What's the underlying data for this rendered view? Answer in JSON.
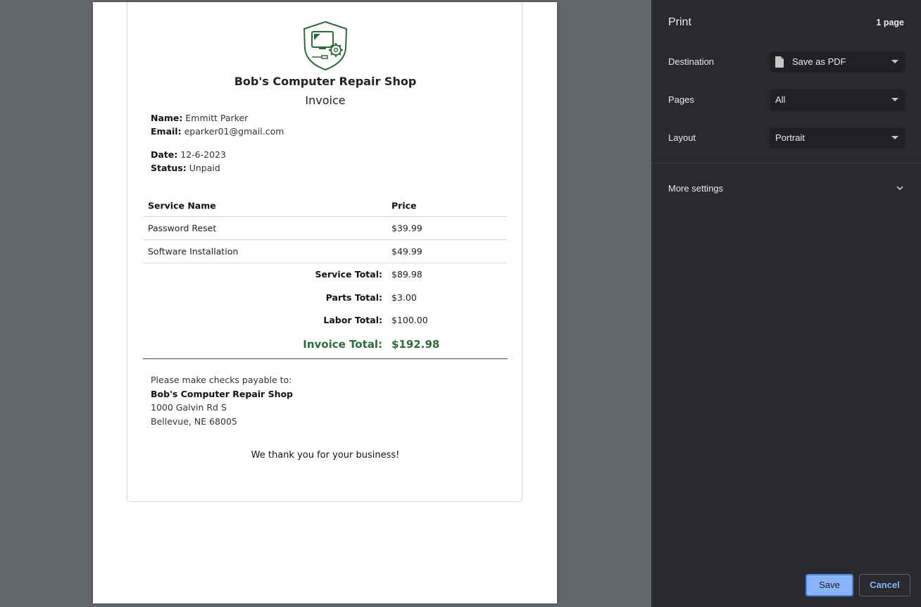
{
  "invoice": {
    "shop_name": "Bob's Computer Repair Shop",
    "title": "Invoice",
    "name_label": "Name:",
    "name_value": "Emmitt Parker",
    "email_label": "Email:",
    "email_value": "eparker01@gmail.com",
    "date_label": "Date:",
    "date_value": "12-6-2023",
    "status_label": "Status:",
    "status_value": "Unpaid",
    "columns": [
      "Service Name",
      "Price"
    ],
    "rows": [
      {
        "service": "Password Reset",
        "price": "$39.99"
      },
      {
        "service": "Software Installation",
        "price": "$49.99"
      }
    ],
    "service_total_label": "Service Total:",
    "service_total": "$89.98",
    "parts_total_label": "Parts Total:",
    "parts_total": "$3.00",
    "labor_total_label": "Labor Total:",
    "labor_total": "$100.00",
    "invoice_total_label": "Invoice Total:",
    "invoice_total": "$192.98",
    "pay_intro": "Please make checks payable to:",
    "pay_name": "Bob's Computer Repair Shop",
    "address_line1": "1000 Galvin Rd S",
    "address_line2": "Bellevue, NE 68005",
    "thanks": "We thank you for your business!",
    "accent_color": "#2f6a3a"
  },
  "print_panel": {
    "title": "Print",
    "page_count": "1 page",
    "destination_label": "Destination",
    "destination_value": "Save as PDF",
    "pages_label": "Pages",
    "pages_value": "All",
    "layout_label": "Layout",
    "layout_value": "Portrait",
    "more_settings": "More settings",
    "save_label": "Save",
    "cancel_label": "Cancel",
    "accent_color": "#8ab4f8"
  }
}
